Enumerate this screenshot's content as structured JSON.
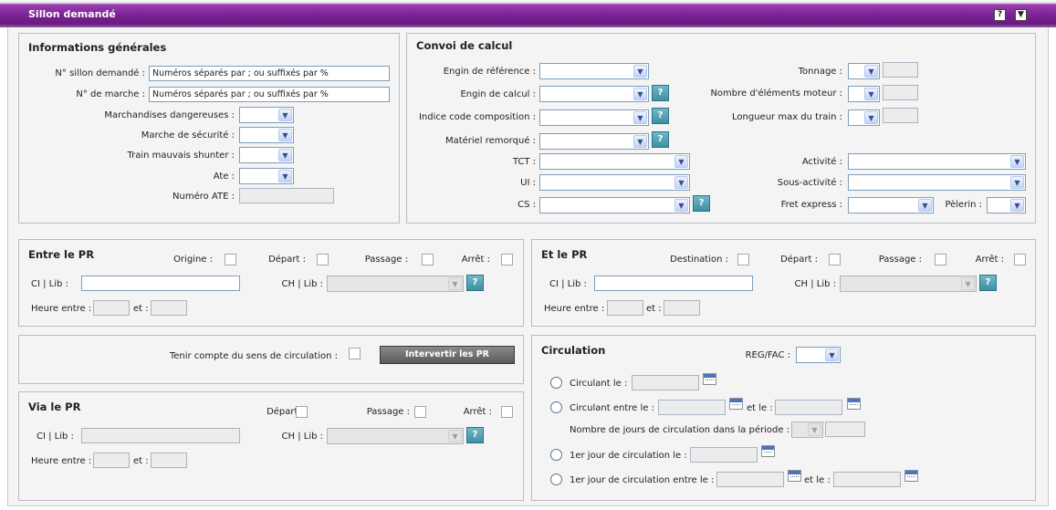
{
  "window": {
    "title": "Sillon demandé",
    "help_glyph": "?",
    "collapse_glyph": "▼"
  },
  "info": {
    "title": "Informations générales",
    "sillon_label": "N° sillon demandé :",
    "sillon_value": "Numéros séparés par ; ou suffixés par %",
    "marche_label": "N° de marche :",
    "marche_value": "Numéros séparés par ; ou suffixés par %",
    "marchandises_label": "Marchandises dangereuses :",
    "securite_label": "Marche de sécurité :",
    "shunter_label": "Train mauvais shunter :",
    "ate_label": "Ate :",
    "numero_ate_label": "Numéro ATE :"
  },
  "convoi": {
    "title": "Convoi de calcul",
    "engin_ref_label": "Engin de référence :",
    "engin_calc_label": "Engin de calcul :",
    "indice_label": "Indice code composition :",
    "materiel_label": "Matériel remorqué :",
    "tct_label": "TCT :",
    "ui_label": "UI :",
    "cs_label": "CS :",
    "tonnage_label": "Tonnage :",
    "nb_elements_label": "Nombre d'éléments moteur :",
    "longueur_label": "Longueur max du train :",
    "activite_label": "Activité :",
    "sous_activite_label": "Sous-activité :",
    "fret_label": "Fret express :",
    "pelerin_label": "Pèlerin :",
    "help": "?"
  },
  "entre": {
    "title": "Entre le PR",
    "origine_label": "Origine :",
    "depart_label": "Départ :",
    "passage_label": "Passage :",
    "arret_label": "Arrêt :",
    "ci_label": "CI | Lib :",
    "ch_label": "CH | Lib :",
    "heure_label": "Heure entre :",
    "et_label": "et :",
    "help": "?"
  },
  "etle": {
    "title": "Et le PR",
    "destination_label": "Destination :",
    "depart_label": "Départ :",
    "passage_label": "Passage :",
    "arret_label": "Arrêt :",
    "ci_label": "CI | Lib :",
    "ch_label": "CH | Lib :",
    "heure_label": "Heure entre :",
    "et_label": "et :",
    "help": "?"
  },
  "sens": {
    "label": "Tenir compte du sens de circulation :",
    "button": "Intervertir les PR"
  },
  "via": {
    "title": "Via le PR",
    "depart_label": "Départ :",
    "passage_label": "Passage :",
    "arret_label": "Arrêt :",
    "ci_label": "CI | Lib :",
    "ch_label": "CH | Lib :",
    "heure_label": "Heure entre :",
    "et_label": "et :",
    "help": "?"
  },
  "circulation": {
    "title": "Circulation",
    "reg_label": "REG/FAC :",
    "circulant_le": "Circulant le :",
    "circulant_entre": "Circulant entre le :",
    "et_le": "et le :",
    "nb_jours": "Nombre de jours de circulation dans la période :",
    "premier_jour": "1er jour de circulation le :",
    "premier_jour_entre": "1er jour de circulation entre le :",
    "et_le2": "et le :"
  },
  "arrow_glyph": "▼"
}
